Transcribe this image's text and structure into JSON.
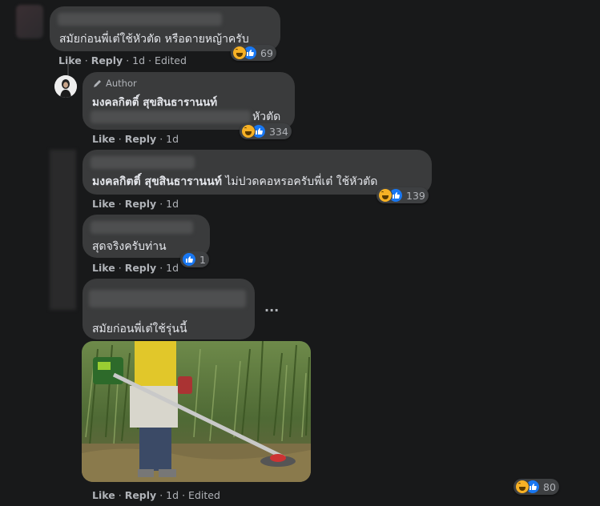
{
  "comments": [
    {
      "text": "สมัยก่อนพี่เต๋ใช้หัวตัด หรือดายหญ้าครับ",
      "actions": {
        "like": "Like",
        "reply": "Reply",
        "time": "1d",
        "edited": "Edited"
      },
      "reactions": {
        "icons": [
          "haha-icon",
          "like-icon"
        ],
        "count": "69"
      }
    },
    {
      "author_badge": "Author",
      "author_name": "มงคลกิตติ์ สุขสินธารานนท์",
      "text": "หัวตัด",
      "actions": {
        "like": "Like",
        "reply": "Reply",
        "time": "1d"
      },
      "reactions": {
        "icons": [
          "haha-icon",
          "like-icon"
        ],
        "count": "334"
      }
    },
    {
      "mention": "มงคลกิตติ์ สุขสินธารานนท์",
      "text": " ไม่ปวดคอหรอครับพี่เต๋ ใช้หัวตัด",
      "actions": {
        "like": "Like",
        "reply": "Reply",
        "time": "1d"
      },
      "reactions": {
        "icons": [
          "haha-icon",
          "like-icon"
        ],
        "count": "139"
      }
    },
    {
      "text": "สุดจริงครับท่าน",
      "actions": {
        "like": "Like",
        "reply": "Reply",
        "time": "1d"
      },
      "reactions": {
        "icons": [
          "like-icon"
        ],
        "count": "1"
      }
    },
    {
      "text": "สมัยก่อนพี่เต๋ใช้รุ่นนี้",
      "more_label": "···",
      "image_alt": "man using a brush cutter in tall grass",
      "actions": {
        "like": "Like",
        "reply": "Reply",
        "time": "1d",
        "edited": "Edited"
      },
      "reactions": {
        "icons": [
          "haha-icon",
          "like-icon"
        ],
        "count": "80"
      }
    }
  ],
  "colors": {
    "background": "#18191a",
    "bubble": "#3a3b3c",
    "text": "#e4e6eb",
    "muted": "#b0b3b8",
    "like_blue": "#1877f2",
    "haha_yellow": "#f7b125"
  }
}
